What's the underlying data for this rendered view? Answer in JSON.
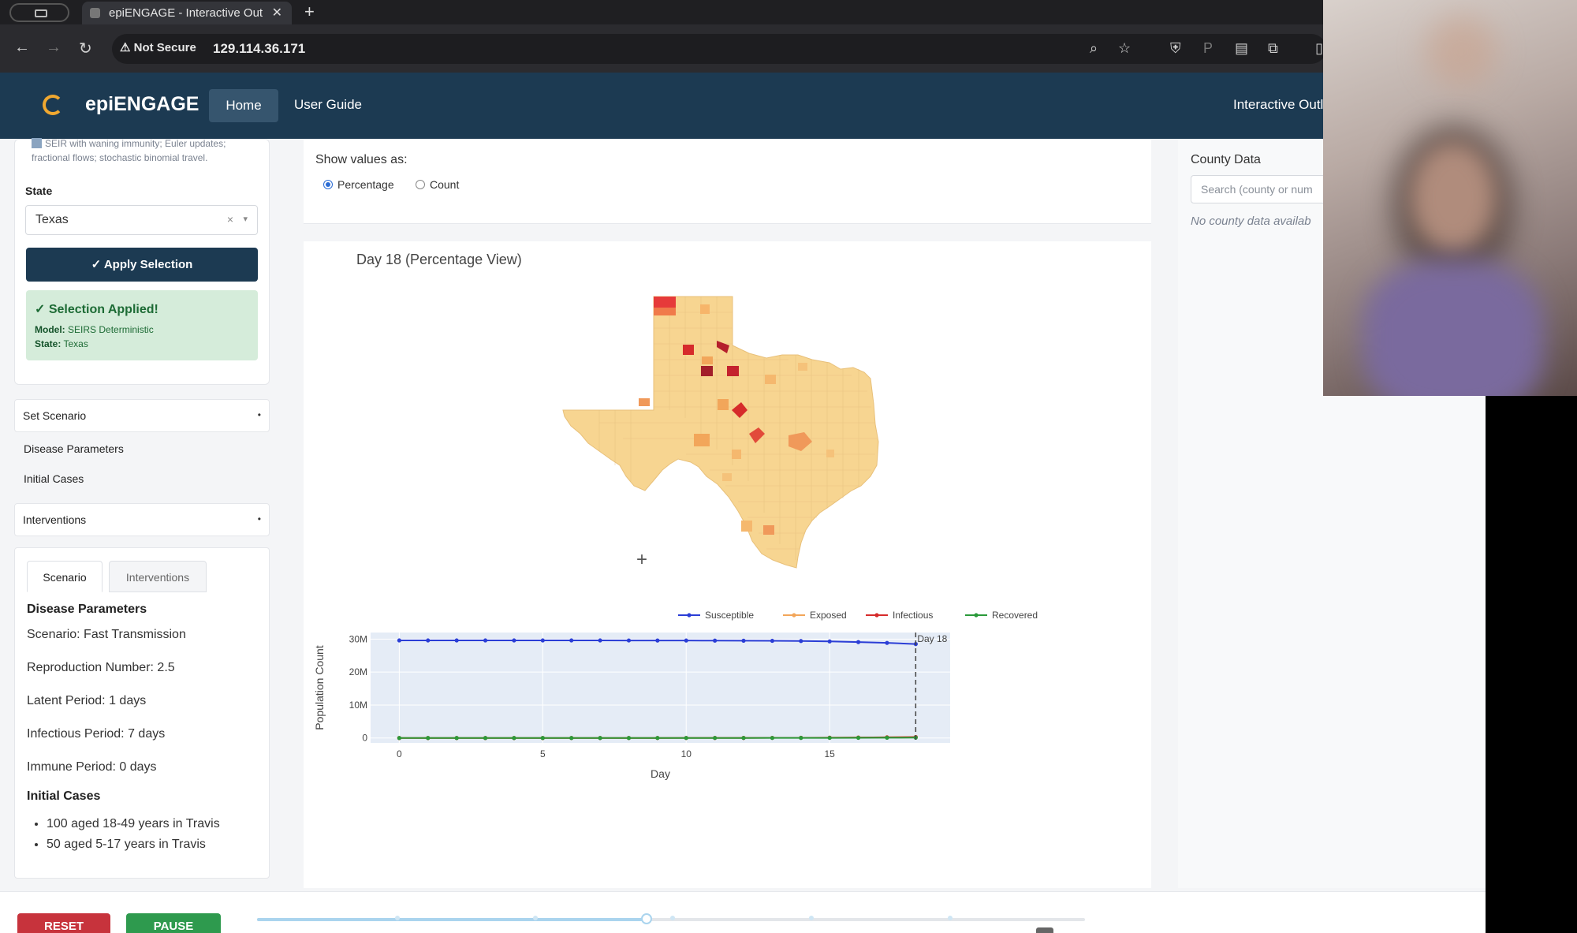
{
  "browser": {
    "tab_title": "epiENGAGE - Interactive Outl",
    "tab_close": "✕",
    "new_tab": "+",
    "security_label": "⚠ Not Secure",
    "url": "129.114.36.171"
  },
  "header": {
    "brand": "epiENGAGE",
    "nav": {
      "home": "Home",
      "guide": "User Guide",
      "right": "Interactive Outl"
    }
  },
  "sidebar": {
    "model_note": "SEIR with waning immunity; Euler updates; fractional flows; stochastic binomial travel.",
    "state_label": "State",
    "state_value": "Texas",
    "state_clear": "×",
    "state_caret": "▾",
    "apply_label": "✓ Apply Selection",
    "applied": {
      "heading": "✓ Selection Applied!",
      "model_key": "Model:",
      "model_value": "SEIRS Deterministic",
      "state_key": "State:",
      "state_value": "Texas"
    },
    "set_scenario": "Set Scenario",
    "disease_parameters_link": "Disease Parameters",
    "initial_cases_link": "Initial Cases",
    "interventions": "Interventions",
    "accordion_marker": "•",
    "tabs": {
      "scenario": "Scenario",
      "interventions": "Interventions"
    },
    "info": {
      "disease_heading": "Disease Parameters",
      "scenario": "Scenario: Fast Transmission",
      "r0": "Reproduction Number: 2.5",
      "latent": "Latent Period: 1 days",
      "infectious": "Infectious Period: 7 days",
      "immune": "Immune Period: 0 days",
      "cases_heading": "Initial Cases",
      "cases": [
        "100 aged 18-49 years in Travis",
        "50 aged 5-17 years in Travis"
      ]
    }
  },
  "center": {
    "show_values_label": "Show values as:",
    "radio_percentage": "Percentage",
    "radio_count": "Count",
    "selected_mode": "Percentage",
    "map_title": "Day 18 (Percentage View)",
    "cursor": "+"
  },
  "right": {
    "title": "County Data",
    "search_placeholder": "Search (county or num",
    "empty": "No county data availab"
  },
  "controls": {
    "reset": "RESET",
    "pause": "PAUSE",
    "slider_position": 0.47
  },
  "colors": {
    "header": "#1c3a52",
    "susceptible": "#2b3ed6",
    "exposed": "#f2a65a",
    "infectious": "#d62b2b",
    "recovered": "#2a9a3a",
    "map_base": "#f7d591"
  },
  "chart_data": {
    "type": "line",
    "xlabel": "Day",
    "ylabel": "Population Count",
    "x": [
      0,
      1,
      2,
      3,
      4,
      5,
      6,
      7,
      8,
      9,
      10,
      11,
      12,
      13,
      14,
      15,
      16,
      17,
      18
    ],
    "xticks": [
      0,
      5,
      10,
      15
    ],
    "ytick_labels": [
      "0",
      "10M",
      "20M",
      "30M"
    ],
    "yticks": [
      0,
      10000000,
      20000000,
      30000000
    ],
    "ylim": [
      -1500000,
      32000000
    ],
    "xlim": [
      -1,
      19.2
    ],
    "marker_day": 18,
    "marker_label": "Day 18",
    "legend_position": "top-right",
    "series": [
      {
        "name": "Susceptible",
        "color": "#2b3ed6",
        "values": [
          29600000,
          29600000,
          29600000,
          29600000,
          29600000,
          29600000,
          29600000,
          29600000,
          29590000,
          29580000,
          29570000,
          29550000,
          29520000,
          29480000,
          29420000,
          29300000,
          29100000,
          28850000,
          28500000
        ]
      },
      {
        "name": "Exposed",
        "color": "#f2a65a",
        "values": [
          150,
          200,
          300,
          500,
          800,
          1300,
          2000,
          3200,
          5000,
          8000,
          12500,
          19000,
          29000,
          44000,
          66000,
          98000,
          145000,
          210000,
          300000
        ]
      },
      {
        "name": "Infectious",
        "color": "#d62b2b",
        "values": [
          0,
          100,
          250,
          450,
          750,
          1200,
          1900,
          3000,
          4800,
          7500,
          11800,
          18000,
          27500,
          41500,
          62000,
          92000,
          135000,
          198000,
          285000
        ]
      },
      {
        "name": "Recovered",
        "color": "#2a9a3a",
        "values": [
          0,
          15,
          50,
          110,
          200,
          350,
          580,
          950,
          1500,
          2400,
          3800,
          6000,
          9300,
          14500,
          22000,
          34000,
          52000,
          78000,
          115000
        ]
      }
    ]
  }
}
